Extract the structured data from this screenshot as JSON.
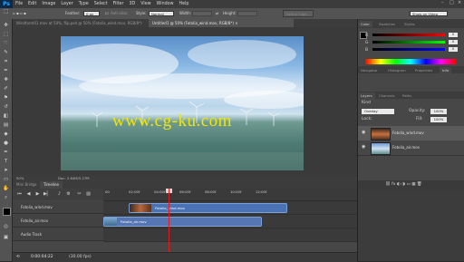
{
  "app": {
    "logo": "Ps"
  },
  "menu": [
    "File",
    "Edit",
    "Image",
    "Layer",
    "Type",
    "Select",
    "Filter",
    "3D",
    "View",
    "Window",
    "Help"
  ],
  "options": {
    "feather_label": "Feather:",
    "feather_value": "0 px",
    "antialias_label": "Anti-alias",
    "style_label": "Style:",
    "style_value": "Normal",
    "width_label": "Width:",
    "height_label": "Height:",
    "refine_edge": "Refine Edge...",
    "workspace": "Show on Video"
  },
  "doc_tabs": [
    {
      "label": "Windfarm01.mov at 50%, flip.psd @ 50% (Fotolia_wind.mov, RGB/8*)",
      "active": false
    },
    {
      "label": "Untitled1 @ 50% (Fotolia_wind.mov, RGB/8*) ×",
      "active": true
    }
  ],
  "canvas": {
    "watermark": "www.cg-ku.com"
  },
  "status": {
    "zoom": "50%",
    "doc": "Doc: 2.64M/5.27M"
  },
  "timeline_tabs": [
    "Mini Bridge",
    "Timeline"
  ],
  "timeline": {
    "ticks": [
      "00",
      "02:00f",
      "04:00f",
      "06:00f",
      "08:00f",
      "10:00f",
      "12:00f"
    ],
    "tracks": [
      {
        "name": "Fotolia_wind.mov",
        "clip": "Fotolia_wind.mov"
      },
      {
        "name": "Fotolia_air.mov",
        "clip": "Fotolia_air.mov"
      },
      {
        "name": "Audio Track",
        "clip": ""
      }
    ],
    "timecode": "0:00:04:22",
    "fps": "(30.00 fps)"
  },
  "panels": {
    "color_tabs": [
      "Color",
      "Swatches",
      "Styles"
    ],
    "rgb": [
      "R",
      "G",
      "B"
    ],
    "rgb_values": [
      "0",
      "0",
      "0"
    ],
    "adjust_tabs": [
      "Navigator",
      "Histogram",
      "Properties",
      "Info"
    ],
    "layers_tabs": [
      "Layers",
      "Channels",
      "Paths"
    ],
    "kind_label": "Kind",
    "blend_mode": "Overlay",
    "opacity_label": "Opacity:",
    "opacity_value": "100%",
    "lock_label": "Lock:",
    "fill_label": "Fill:",
    "fill_value": "100%",
    "layers": [
      {
        "name": "Fotolia_wind.mov"
      },
      {
        "name": "Fotolia_air.mov"
      }
    ]
  }
}
